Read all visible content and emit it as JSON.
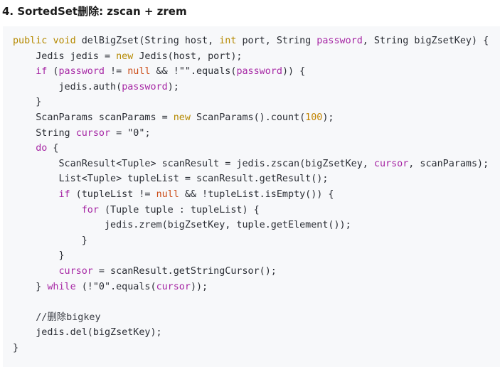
{
  "page": {
    "title": "4. SortedSet删除: zscan + zrem",
    "background_color": "#ffffff"
  },
  "code_block": {
    "language": "java",
    "background_color": "#f7f8fa",
    "text_color": "#2a2d34",
    "keyword_color": "#b58900",
    "control_keyword_color": "#a626a4",
    "number_color": "#c18401",
    "null_color": "#cb4b16",
    "variable_color": "#a626a4",
    "comment_color": "#3a3d44",
    "lines": [
      "public void delBigZset(String host, int port, String password, String bigZsetKey) {",
      "    Jedis jedis = new Jedis(host, port);",
      "    if (password != null && !\"\".equals(password)) {",
      "        jedis.auth(password);",
      "    }",
      "    ScanParams scanParams = new ScanParams().count(100);",
      "    String cursor = \"0\";",
      "    do {",
      "        ScanResult<Tuple> scanResult = jedis.zscan(bigZsetKey, cursor, scanParams);",
      "        List<Tuple> tupleList = scanResult.getResult();",
      "        if (tupleList != null && !tupleList.isEmpty()) {",
      "            for (Tuple tuple : tupleList) {",
      "                jedis.zrem(bigZsetKey, tuple.getElement());",
      "            }",
      "        }",
      "        cursor = scanResult.getStringCursor();",
      "    } while (!\"0\".equals(cursor));",
      "",
      "    //删除bigkey",
      "    jedis.del(bigZsetKey);",
      "}"
    ],
    "tokens": {
      "keywords": [
        "public",
        "void",
        "int",
        "new"
      ],
      "control_keywords": [
        "if",
        "do",
        "for",
        "while"
      ],
      "literals": [
        "null",
        "100",
        "\"0\"",
        "\"\""
      ],
      "highlighted_vars": [
        "password",
        "cursor"
      ],
      "comment": "//删除bigkey"
    }
  }
}
